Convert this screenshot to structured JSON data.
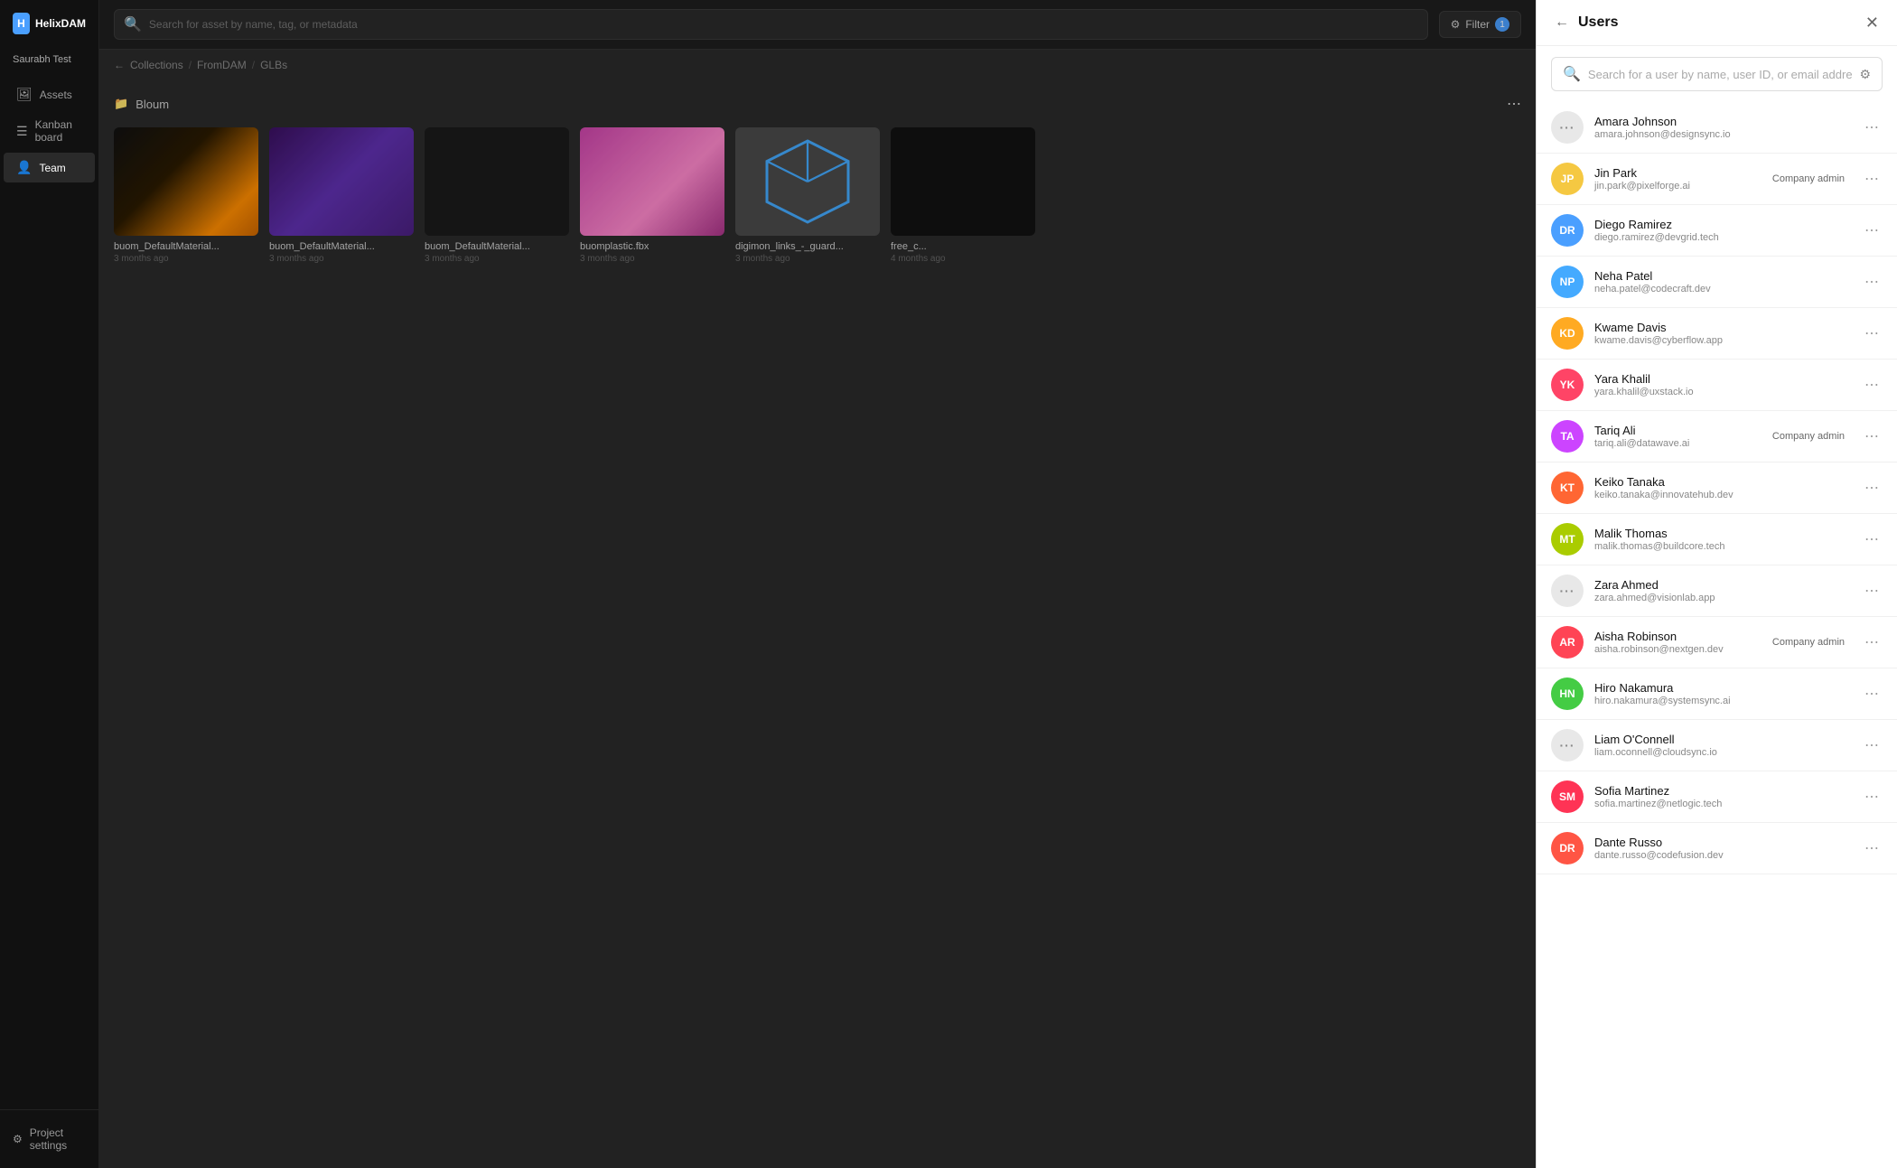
{
  "app": {
    "logo_text": "HelixDAM",
    "workspace": "Saurabh Test"
  },
  "sidebar": {
    "nav_items": [
      {
        "id": "assets",
        "label": "Assets",
        "icon": "🖼"
      },
      {
        "id": "kanban",
        "label": "Kanban board",
        "icon": "📋"
      },
      {
        "id": "team",
        "label": "Team",
        "icon": "👤"
      }
    ],
    "bottom_items": [
      {
        "id": "project-settings",
        "label": "Project settings",
        "icon": "⚙"
      }
    ]
  },
  "topbar": {
    "search_placeholder": "Search for asset by name, tag, or metadata",
    "filter_label": "Filter",
    "filter_count": "1"
  },
  "breadcrumb": {
    "items": [
      "Collections",
      "FromDAM",
      "GLBs"
    ],
    "back_arrow": "←"
  },
  "collection": {
    "name": "Bloum",
    "assets": [
      {
        "name": "buom_DefaultMaterial...",
        "date": "3 months ago",
        "thumb_type": "butterfly-1"
      },
      {
        "name": "buom_DefaultMaterial...",
        "date": "3 months ago",
        "thumb_type": "purple-wave"
      },
      {
        "name": "buom_DefaultMaterial...",
        "date": "3 months ago",
        "thumb_type": "dark-feather"
      },
      {
        "name": "buomplastic.fbx",
        "date": "3 months ago",
        "thumb_type": "pink-creature"
      },
      {
        "name": "digimon_links_-_guard...",
        "date": "3 months ago",
        "thumb_type": "3d-box"
      },
      {
        "name": "free_c...",
        "date": "4 months ago",
        "thumb_type": "dark-scene"
      }
    ]
  },
  "users_panel": {
    "title": "Users",
    "search_placeholder": "Search for a user by name, user ID, or email address",
    "users": [
      {
        "id": "u1",
        "name": "Amara Johnson",
        "email": "amara.johnson@designsync.io",
        "avatar_color": null,
        "is_placeholder": true,
        "badge": null
      },
      {
        "id": "u2",
        "name": "Jin Park",
        "email": "jin.park@pixelforge.ai",
        "avatar_color": "#f5c842",
        "is_placeholder": false,
        "badge": "Company admin"
      },
      {
        "id": "u3",
        "name": "Diego Ramirez",
        "email": "diego.ramirez@devgrid.tech",
        "avatar_color": "#4a9fff",
        "is_placeholder": false,
        "badge": null
      },
      {
        "id": "u4",
        "name": "Neha Patel",
        "email": "neha.patel@codecraft.dev",
        "avatar_color": "#44aaff",
        "is_placeholder": false,
        "badge": null
      },
      {
        "id": "u5",
        "name": "Kwame Davis",
        "email": "kwame.davis@cyberflow.app",
        "avatar_color": "#ffaa22",
        "is_placeholder": false,
        "badge": null
      },
      {
        "id": "u6",
        "name": "Yara Khalil",
        "email": "yara.khalil@uxstack.io",
        "avatar_color": "#ff4466",
        "is_placeholder": false,
        "badge": null
      },
      {
        "id": "u7",
        "name": "Tariq Ali",
        "email": "tariq.ali@datawave.ai",
        "avatar_color": "#cc44ff",
        "is_placeholder": false,
        "badge": "Company admin"
      },
      {
        "id": "u8",
        "name": "Keiko Tanaka",
        "email": "keiko.tanaka@innovatehub.dev",
        "avatar_color": "#ff6633",
        "is_placeholder": false,
        "badge": null
      },
      {
        "id": "u9",
        "name": "Malik Thomas",
        "email": "malik.thomas@buildcore.tech",
        "avatar_color": "#aacc00",
        "is_placeholder": false,
        "badge": null
      },
      {
        "id": "u10",
        "name": "Zara Ahmed",
        "email": "zara.ahmed@visionlab.app",
        "avatar_color": null,
        "is_placeholder": true,
        "badge": null
      },
      {
        "id": "u11",
        "name": "Aisha Robinson",
        "email": "aisha.robinson@nextgen.dev",
        "avatar_color": "#ff4455",
        "is_placeholder": false,
        "badge": "Company admin"
      },
      {
        "id": "u12",
        "name": "Hiro Nakamura",
        "email": "hiro.nakamura@systemsync.ai",
        "avatar_color": "#44cc44",
        "is_placeholder": false,
        "badge": null
      },
      {
        "id": "u13",
        "name": "Liam O'Connell",
        "email": "liam.oconnell@cloudsync.io",
        "avatar_color": null,
        "is_placeholder": true,
        "badge": null
      },
      {
        "id": "u14",
        "name": "Sofia Martinez",
        "email": "sofia.martinez@netlogic.tech",
        "avatar_color": "#ff3355",
        "is_placeholder": false,
        "badge": null
      },
      {
        "id": "u15",
        "name": "Dante Russo",
        "email": "dante.russo@codefusion.dev",
        "avatar_color": "#ff5544",
        "is_placeholder": false,
        "badge": null
      }
    ]
  }
}
